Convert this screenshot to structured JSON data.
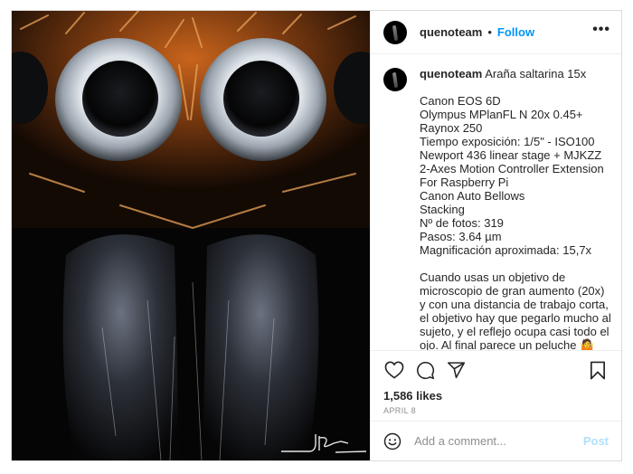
{
  "post": {
    "author": "quenoteam",
    "separator": "•",
    "follow_label": "Follow",
    "more_label": "•••",
    "image_alt": "Macro photograph of a jumping spider's face with large eyes and orange hairs",
    "signature": "JRapun"
  },
  "caption": {
    "author": "quenoteam",
    "title": "Araña saltarina 15x",
    "lines": [
      "Canon EOS 6D",
      "Olympus MPlanFL N 20x 0.45+",
      "Raynox 250",
      "Tiempo exposición: 1/5\" - ISO100",
      "Newport 436 linear stage + MJKZZ",
      "2-Axes Motion Controller Extension",
      "For Raspberry Pi",
      "Canon Auto Bellows",
      "Stacking",
      "Nº de fotos: 319",
      "Pasos: 3.64 µm",
      "Magnificación aproximada: 15,7x"
    ],
    "paragraph": [
      "Cuando usas un objetivo de",
      "microscopio de gran aumento (20x)",
      "y con una distancia de trabajo corta,",
      "el objetivo hay que pegarlo mucho al",
      "sujeto, y el reflejo ocupa casi todo el",
      "ojo. Al final parece un peluche 🤷"
    ]
  },
  "engagement": {
    "likes": "1,586 likes",
    "date": "APRIL 8"
  },
  "comment": {
    "placeholder": "Add a comment...",
    "post_label": "Post"
  },
  "colors": {
    "follow_blue": "#0095f6",
    "post_disabled_blue": "#b2dffc",
    "border": "#dbdbdb",
    "muted_text": "#8e8e8e"
  }
}
